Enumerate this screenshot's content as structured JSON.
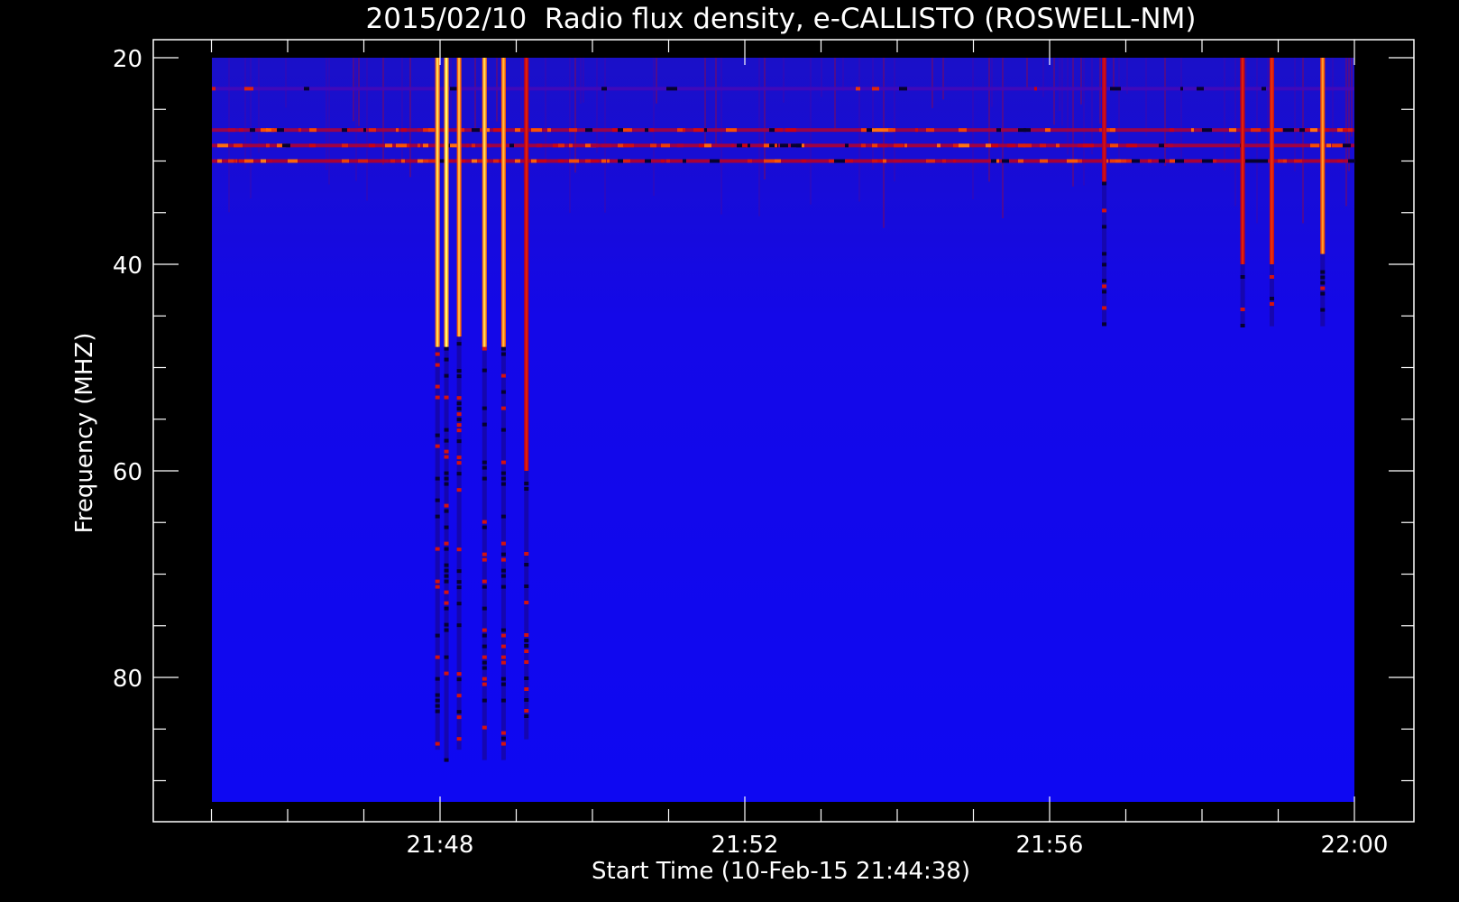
{
  "chart_data": {
    "type": "heatmap",
    "title": "2015/02/10  Radio flux density, e-CALLISTO (ROSWELL-NM)",
    "xlabel": "Start Time (10-Feb-15 21:44:38)",
    "ylabel": "Frequency (MHZ)",
    "x_ticks": [
      "21:48",
      "21:52",
      "21:56",
      "22:00"
    ],
    "y_ticks": [
      "20",
      "40",
      "60",
      "80"
    ],
    "x_range": [
      "21:44:38",
      "22:00:00"
    ],
    "ylim": [
      20,
      92
    ],
    "y_inverted": true,
    "grid": false,
    "colormap": [
      "#000000",
      "#0000ff",
      "#cc0000",
      "#ff6600",
      "#ffff66"
    ],
    "background_color": "#0000ff",
    "features": [
      {
        "kind": "vertical-burst",
        "time": "21:47:58",
        "f_low": 20,
        "f_high": 87,
        "peak_f_high": 48,
        "intensity": 0.95
      },
      {
        "kind": "vertical-burst",
        "time": "21:48:05",
        "f_low": 20,
        "f_high": 88,
        "peak_f_high": 48,
        "intensity": 1.0
      },
      {
        "kind": "vertical-burst",
        "time": "21:48:15",
        "f_low": 20,
        "f_high": 87,
        "peak_f_high": 47,
        "intensity": 0.9
      },
      {
        "kind": "vertical-burst",
        "time": "21:48:35",
        "f_low": 20,
        "f_high": 88,
        "peak_f_high": 48,
        "intensity": 0.95
      },
      {
        "kind": "vertical-burst",
        "time": "21:48:50",
        "f_low": 20,
        "f_high": 88,
        "peak_f_high": 48,
        "intensity": 0.9
      },
      {
        "kind": "vertical-burst",
        "time": "21:49:08",
        "f_low": 20,
        "f_high": 86,
        "peak_f_high": 60,
        "intensity": 0.6
      },
      {
        "kind": "vertical-burst",
        "time": "21:56:43",
        "f_low": 20,
        "f_high": 46,
        "peak_f_high": 32,
        "intensity": 0.55
      },
      {
        "kind": "vertical-burst",
        "time": "21:58:32",
        "f_low": 20,
        "f_high": 46,
        "peak_f_high": 40,
        "intensity": 0.6
      },
      {
        "kind": "vertical-burst",
        "time": "21:58:55",
        "f_low": 20,
        "f_high": 46,
        "peak_f_high": 40,
        "intensity": 0.65
      },
      {
        "kind": "vertical-burst",
        "time": "21:59:35",
        "f_low": 20,
        "f_high": 46,
        "peak_f_high": 39,
        "intensity": 0.85
      },
      {
        "kind": "interference-band",
        "f_center": 23,
        "intensity": 0.2
      },
      {
        "kind": "interference-band",
        "f_center": 27,
        "intensity": 0.7
      },
      {
        "kind": "interference-band",
        "f_center": 28.5,
        "intensity": 0.75
      },
      {
        "kind": "interference-band",
        "f_center": 30,
        "intensity": 0.8
      }
    ]
  }
}
